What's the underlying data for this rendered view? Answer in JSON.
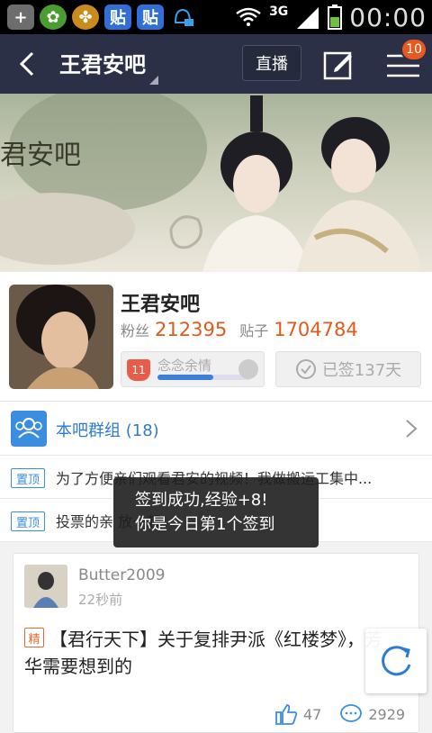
{
  "status_bar": {
    "network": "3G",
    "time": "00:00"
  },
  "header": {
    "title": "王君安吧",
    "live_label": "直播",
    "badge_count": "10"
  },
  "forum": {
    "name": "王君安吧",
    "fans_label": "粉丝",
    "fans_count": "212395",
    "posts_label": "贴子",
    "posts_count": "1704784",
    "level": "11",
    "level_name": "念念余情",
    "level_progress": 0.6,
    "signed_label": "已签137天"
  },
  "group": {
    "label": "本吧群组 (18)"
  },
  "pinned": [
    {
      "tag": "置顶",
      "text": "为了方便亲们观看君安的视频！我做搬运工集中..."
    },
    {
      "tag": "置顶",
      "text": "投票的亲      放一起"
    }
  ],
  "toast": {
    "line1": "签到成功,经验+8!",
    "line2": "你是今日第1个签到"
  },
  "post": {
    "username": "Butter2009",
    "time": "22秒前",
    "tag": "精",
    "title": "【君行天下】关于复排尹派《红楼梦》，芳华需要想到的",
    "likes": "47",
    "comments": "2929"
  },
  "colors": {
    "header_bg": "#2b3046",
    "accent_orange": "#e05a1a",
    "link_blue": "#2e7bd0"
  }
}
